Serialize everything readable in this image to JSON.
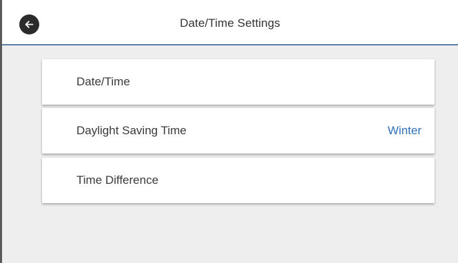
{
  "header": {
    "title": "Date/Time Settings",
    "back_icon": "arrow-left-icon"
  },
  "menu": {
    "items": [
      {
        "label": "Date/Time",
        "value": ""
      },
      {
        "label": "Daylight Saving Time",
        "value": "Winter"
      },
      {
        "label": "Time Difference",
        "value": ""
      }
    ]
  },
  "colors": {
    "accent_value": "#2f6fba",
    "header_divider": "#5e7fa3",
    "background": "#eeeeee"
  }
}
